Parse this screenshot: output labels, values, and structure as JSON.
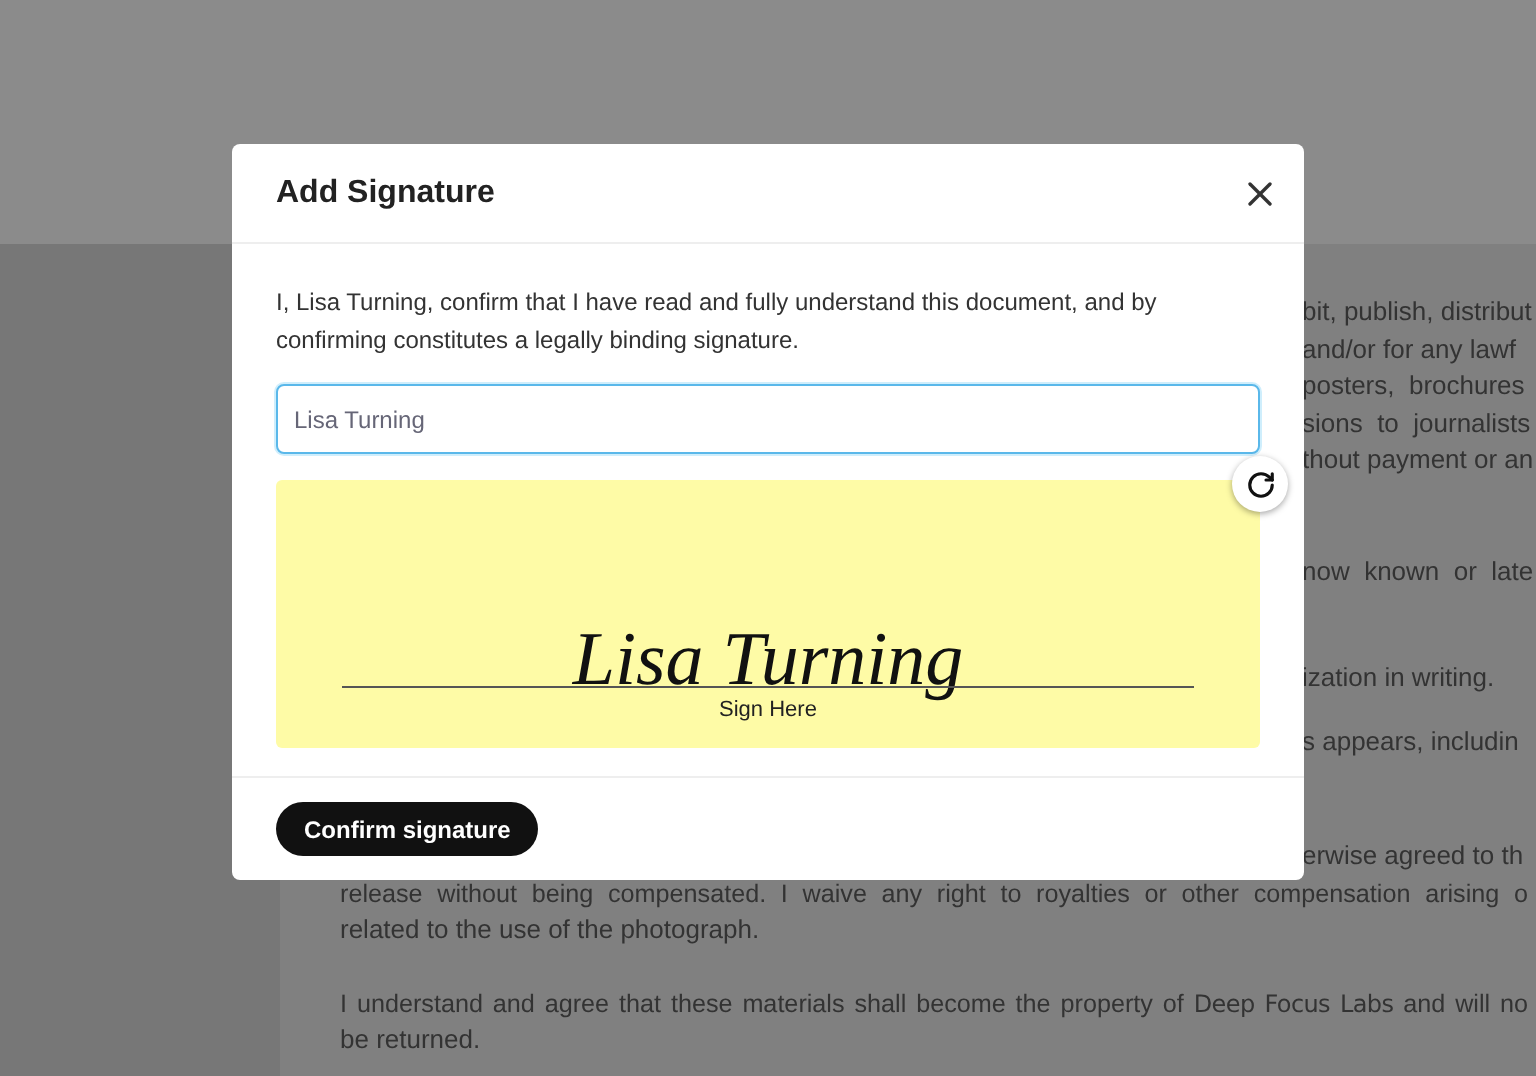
{
  "document": {
    "right_fragments": [
      [
        "bit, publish, distribut",
        "and/or for any lawf",
        "posters,  brochures",
        "sions  to  journalists",
        "thout payment or an"
      ],
      [
        "now  known  or  late"
      ],
      [
        "ization in writing."
      ],
      [
        "s appears, includin"
      ]
    ],
    "below_fragment": "erwise agreed to th",
    "paragraph_1": [
      "release without being compensated. I waive any right to royalties or other compensation arising o",
      "related to the use of the photograph."
    ],
    "paragraph_2": {
      "before": "I understand and agree that these materials shall become the property of ",
      "company": "Deep Focus Labs",
      "after": " and will no",
      "last_line": "be returned."
    }
  },
  "dialog": {
    "title": "Add Signature",
    "statement": "I, Lisa Turning, confirm that I have read and fully understand this document, and by confirming constitutes a legally binding signature.",
    "name_field": {
      "value": "Lisa Turning"
    },
    "signature": "Lisa Turning",
    "sign_here": "Sign Here",
    "confirm_button": "Confirm signature"
  }
}
